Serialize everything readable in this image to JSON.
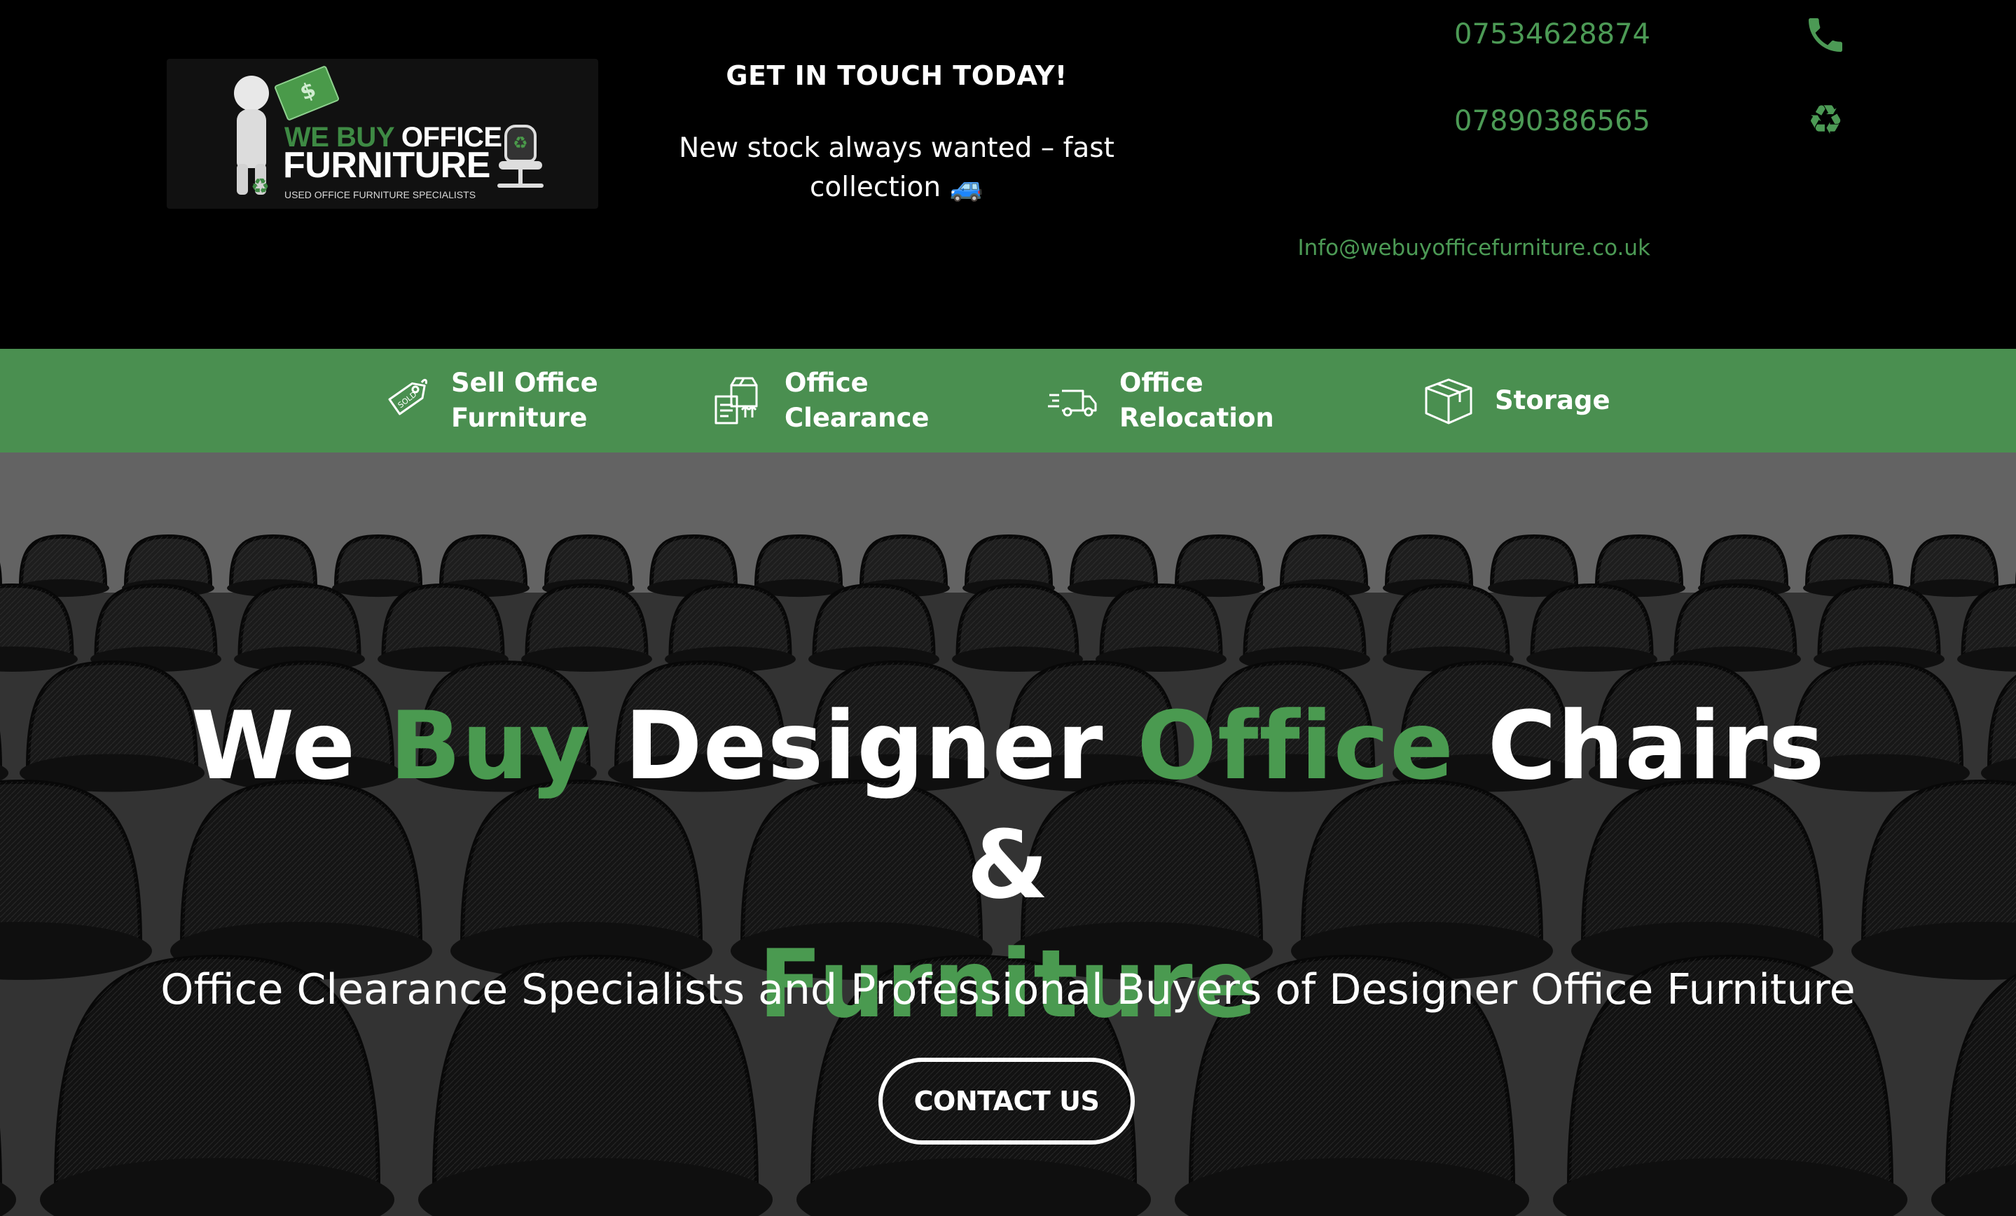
{
  "header": {
    "logo": {
      "line1_green": "WE BUY",
      "line1_white": "OFFICE",
      "line2": "FURNITURE",
      "tagline": "USED OFFICE FURNITURE SPECIALISTS"
    },
    "touch_title": "GET IN TOUCH TODAY!",
    "stock_text": "New stock always wanted – fast collection 🚙",
    "phone1": "07534628874",
    "phone2": "07890386565",
    "email": "Info@webuyofficefurniture.co.uk",
    "icons": {
      "phone": "phone-icon",
      "recycle": "recycle-icon"
    },
    "accent_color": "#4c9a55"
  },
  "nav": {
    "background": "#4a8f50",
    "items": [
      {
        "label_line1": "Sell Office",
        "label_line2": "Furniture",
        "icon": "sold-tag-icon"
      },
      {
        "label_line1": "Office",
        "label_line2": "Clearance",
        "icon": "clearance-boxes-icon"
      },
      {
        "label_line1": "Office",
        "label_line2": "Relocation",
        "icon": "delivery-truck-icon"
      },
      {
        "label_line1": "Storage",
        "label_line2": "",
        "icon": "storage-box-icon"
      }
    ]
  },
  "hero": {
    "title_parts": [
      {
        "text": "We ",
        "green": false
      },
      {
        "text": "Buy",
        "green": true
      },
      {
        "text": " Designer ",
        "green": false
      },
      {
        "text": "Office",
        "green": true
      },
      {
        "text": " Chairs &",
        "green": false
      },
      {
        "text": "Furniture",
        "green": true
      }
    ],
    "subtitle": "Office Clearance Specialists and Professional Buyers of Designer Office Furniture",
    "cta_label": "CONTACT US",
    "green_color": "#4a9a50"
  }
}
